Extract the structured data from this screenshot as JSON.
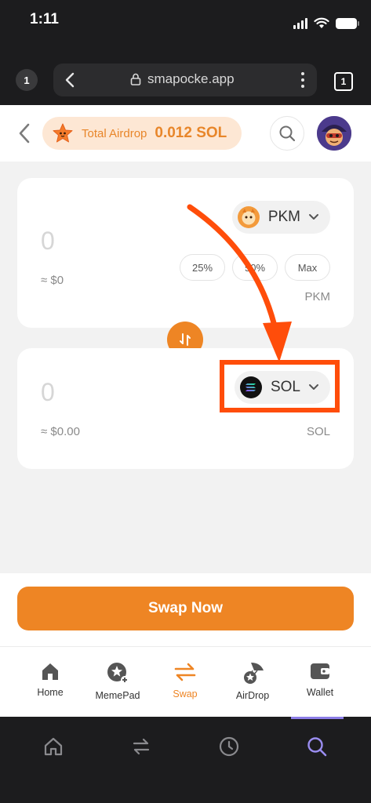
{
  "status_bar": {
    "time": "1:11"
  },
  "browser": {
    "tab_badge": "1",
    "url": "smapocke.app",
    "tabs_count": "1"
  },
  "header": {
    "airdrop_label": "Total Airdrop",
    "airdrop_value": "0.012 SOL"
  },
  "from_card": {
    "amount": "0",
    "fiat": "≈ $0",
    "token": "PKM",
    "token_symbol": "PKM",
    "percent_buttons": [
      "25%",
      "50%",
      "Max"
    ]
  },
  "to_card": {
    "amount": "0",
    "fiat": "≈ $0.00",
    "token": "SOL",
    "token_symbol": "SOL"
  },
  "action": {
    "swap_label": "Swap Now"
  },
  "bottom_nav": {
    "items": [
      {
        "label": "Home",
        "icon": "home-icon"
      },
      {
        "label": "MemePad",
        "icon": "memepad-icon"
      },
      {
        "label": "Swap",
        "icon": "swap-icon",
        "active": true
      },
      {
        "label": "AirDrop",
        "icon": "airdrop-icon"
      },
      {
        "label": "Wallet",
        "icon": "wallet-icon"
      }
    ]
  },
  "browser_toolbar": {
    "items": [
      "home-icon",
      "swap-arrows-icon",
      "history-icon",
      "search-icon"
    ]
  },
  "colors": {
    "accent": "#ee8524",
    "annotation": "#ff4d0a",
    "pill_bg": "#fde7d4",
    "browser_active": "#8d7ee8"
  }
}
